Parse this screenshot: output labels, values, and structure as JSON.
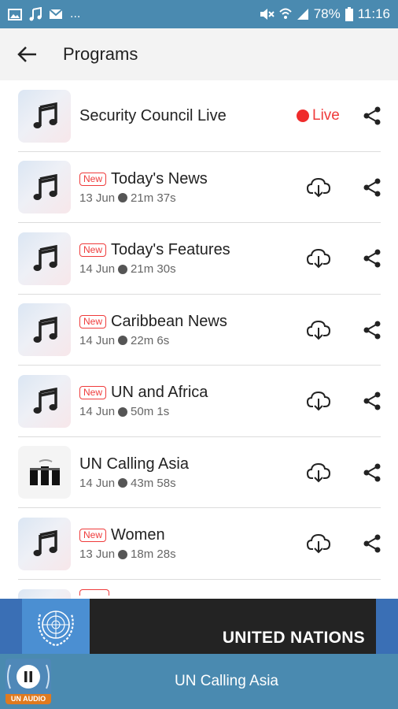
{
  "status_bar": {
    "left_icons": [
      "image-icon",
      "music-note-icon",
      "mail-icon"
    ],
    "more": "...",
    "battery": "78%",
    "time": "11:16"
  },
  "app_bar": {
    "title": "Programs"
  },
  "live_row": {
    "title": "Security Council Live",
    "live_label": "Live"
  },
  "programs": [
    {
      "badge": "New",
      "title": "Today's News",
      "date": "13 Jun",
      "duration": "21m 37s"
    },
    {
      "badge": "New",
      "title": "Today's Features",
      "date": "14 Jun",
      "duration": "21m 30s"
    },
    {
      "badge": "New",
      "title": "Caribbean News",
      "date": "14 Jun",
      "duration": "22m 6s"
    },
    {
      "badge": "New",
      "title": "UN and Africa",
      "date": "14 Jun",
      "duration": "50m 1s"
    },
    {
      "badge": "",
      "title": "UN Calling Asia",
      "date": "14 Jun",
      "duration": "43m 58s"
    },
    {
      "badge": "New",
      "title": "Women",
      "date": "13 Jun",
      "duration": "18m 28s"
    }
  ],
  "banner": {
    "text": "UNITED NATIONS"
  },
  "player": {
    "title": "UN Calling Asia",
    "logo_tag": "UN AUDIO"
  },
  "colors": {
    "accent": "#4a8ab0",
    "live": "#ef2b2b",
    "banner_blue": "#3a6fb5"
  }
}
